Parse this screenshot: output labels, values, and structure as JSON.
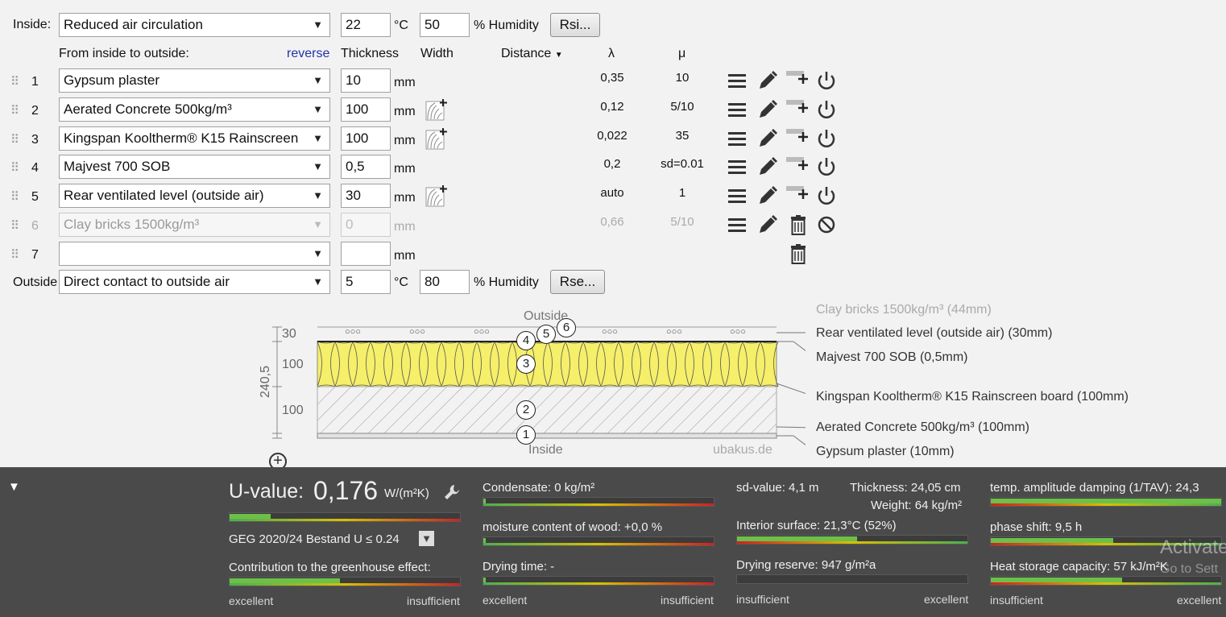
{
  "inside": {
    "label": "Inside:",
    "climate": "Reduced air circulation",
    "temp": "22",
    "temp_unit": "°C",
    "humidity": "50",
    "humidity_label": "% Humidity",
    "rsi_button": "Rsi..."
  },
  "outside": {
    "label": "Outside",
    "climate": "Direct contact to outside air",
    "temp": "5",
    "temp_unit": "°C",
    "humidity": "80",
    "humidity_label": "% Humidity",
    "rse_button": "Rse..."
  },
  "headers": {
    "direction": "From inside to outside:",
    "reverse": "reverse",
    "thickness": "Thickness",
    "width": "Width",
    "distance": "Distance",
    "lambda": "λ",
    "mu": "μ"
  },
  "layers": [
    {
      "n": "1",
      "material": "Gypsum plaster",
      "thickness": "10",
      "unit": "mm",
      "lambda": "0,35",
      "mu": "10"
    },
    {
      "n": "2",
      "material": "Aerated Concrete 500kg/m³",
      "thickness": "100",
      "unit": "mm",
      "lambda": "0,12",
      "mu": "5/10"
    },
    {
      "n": "3",
      "material": "Kingspan Kooltherm® K15 Rainscreen",
      "thickness": "100",
      "unit": "mm",
      "lambda": "0,022",
      "mu": "35"
    },
    {
      "n": "4",
      "material": "Majvest 700 SOB",
      "thickness": "0,5",
      "unit": "mm",
      "lambda": "0,2",
      "mu": "sd=0.01"
    },
    {
      "n": "5",
      "material": "Rear ventilated level (outside air)",
      "thickness": "30",
      "unit": "mm",
      "lambda": "auto",
      "mu": "1"
    },
    {
      "n": "6",
      "material": "Clay bricks 1500kg/m³",
      "thickness": "0",
      "unit": "mm",
      "lambda": "0,66",
      "mu": "5/10"
    },
    {
      "n": "7",
      "material": "",
      "thickness": "",
      "unit": "mm",
      "lambda": "",
      "mu": ""
    }
  ],
  "diagram": {
    "top_label": "Outside",
    "bottom_label": "Inside",
    "watermark": "ubakus.de",
    "dim_total": "240,5",
    "dim_30": "30",
    "dim_100a": "100",
    "dim_100b": "100",
    "callouts": [
      "Clay bricks 1500kg/m³ (44mm)",
      "Rear ventilated level (outside air) (30mm)",
      "Majvest 700 SOB (0,5mm)",
      "Kingspan Kooltherm® K15 Rainscreen board (100mm)",
      "Aerated Concrete 500kg/m³ (100mm)",
      "Gypsum plaster (10mm)"
    ],
    "markers": [
      "1",
      "2",
      "3",
      "4",
      "5",
      "6"
    ],
    "vent_marks": "○○○"
  },
  "results": {
    "u_label": "U-value:",
    "u_value": "0,176",
    "u_unit": "W/(m²K)",
    "u_fill": 0.18,
    "standard": "GEG 2020/24 Bestand U ≤ 0.24",
    "greenhouse_label": "Contribution to the greenhouse effect:",
    "greenhouse_fill": 0.48,
    "excellent": "excellent",
    "insufficient": "insufficient",
    "condensate": "Condensate: 0 kg/m²",
    "condensate_fill": 0.01,
    "wood_moisture": "moisture content of wood: +0,0 %",
    "wood_fill": 0.01,
    "drying_time": "Drying time: -",
    "drying_fill": 0.01,
    "sd_value": "sd-value: 4,1 m",
    "thickness": "Thickness: 24,05 cm",
    "weight": "Weight: 64 kg/m²",
    "interior_surface": "Interior surface: 21,3°C (52%)",
    "interior_fill": 0.52,
    "drying_reserve": "Drying reserve: 947 g/m²a",
    "drying_reserve_fill": 0.0,
    "tav": "temp. amplitude damping (1/TAV): 24,3",
    "tav_fill": 1.0,
    "phase_shift": "phase shift: 9,5 h",
    "phase_fill": 0.53,
    "heat_storage": "Heat storage capacity: 57 kJ/m²K",
    "heat_fill": 0.57,
    "watermark1": "Activate",
    "watermark2": "Go to Sett"
  }
}
